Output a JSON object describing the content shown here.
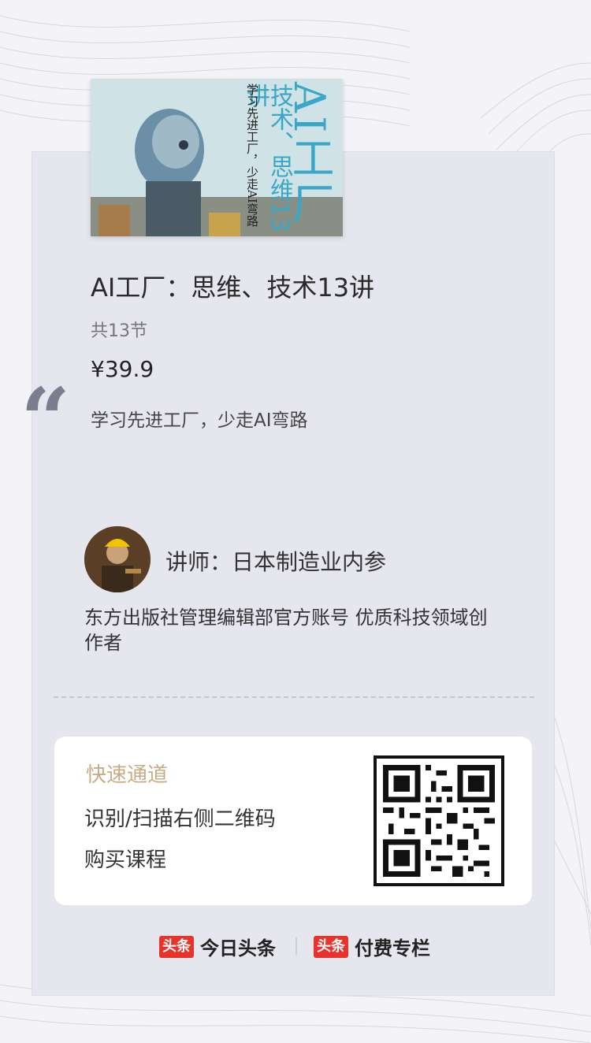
{
  "cover": {
    "title_big": "AI工厂",
    "title_mid": "技术、思维13讲",
    "subtitle": "学习先进工厂，少走AI弯路"
  },
  "course": {
    "quote_mark": "“",
    "title": "AI工厂：思维、技术13讲",
    "sections": "共13节",
    "price": "¥39.9",
    "slogan": "学习先进工厂，少走AI弯路"
  },
  "teacher": {
    "label": "讲师：日本制造业内参",
    "description": " 东方出版社管理编辑部官方账号 优质科技领域创作者"
  },
  "quick": {
    "title": "快速通道",
    "line1": "识别/扫描右侧二维码",
    "line2": "购买课程"
  },
  "footer": {
    "logo1": "头条",
    "brand1": "今日头条",
    "logo2": "头条",
    "brand2": "付费专栏"
  },
  "colors": {
    "accent_gold": "#c7ad84",
    "brand_red": "#e8332c",
    "card_bg": "#e6e6ee"
  }
}
